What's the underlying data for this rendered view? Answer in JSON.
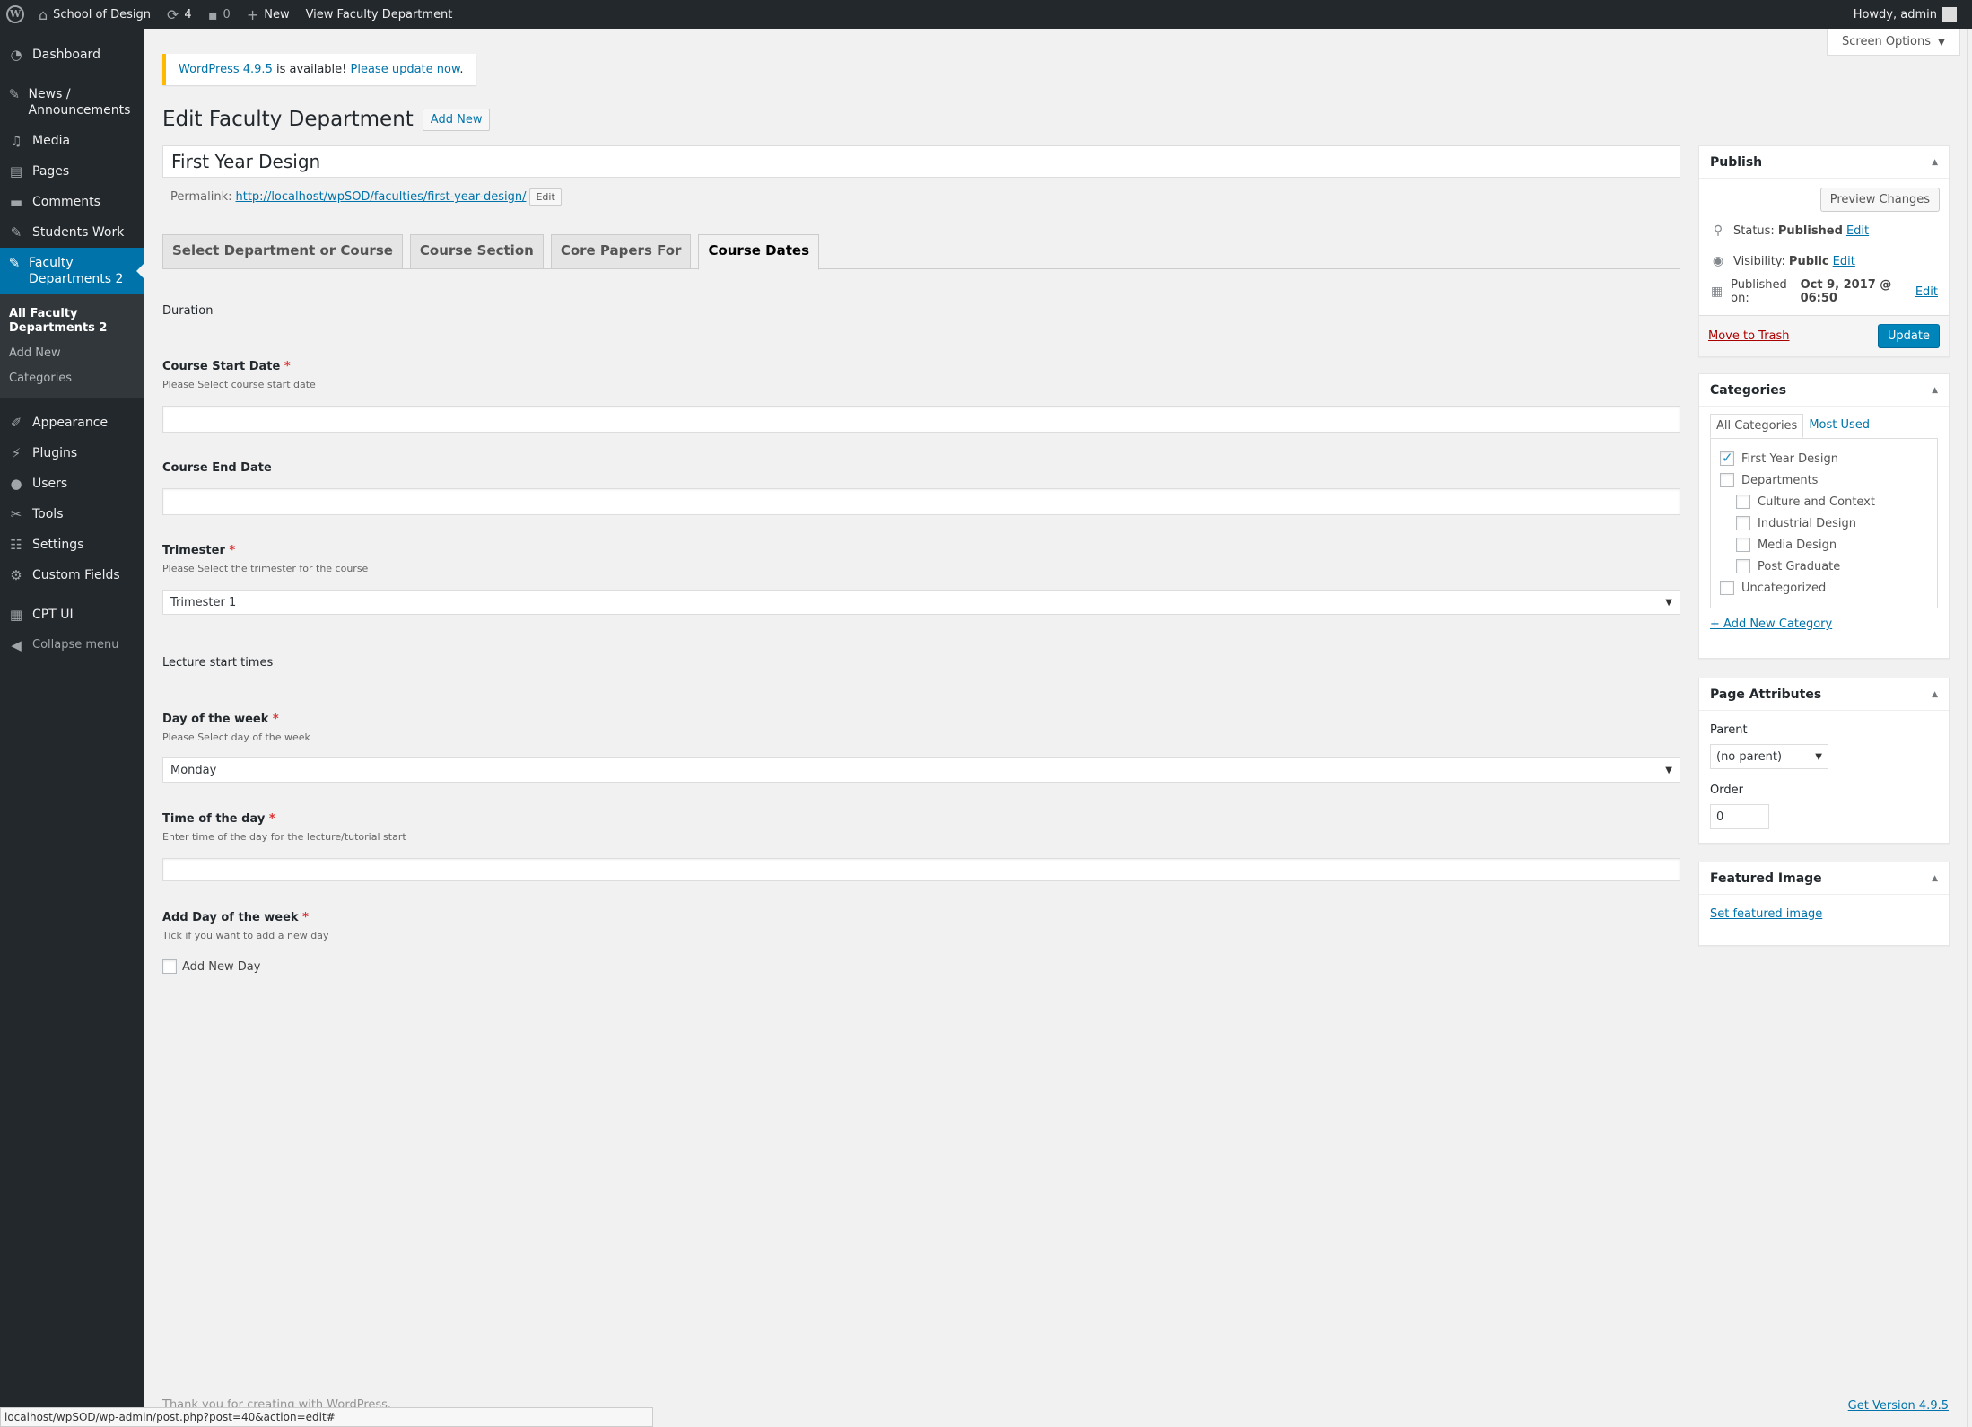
{
  "adminbar": {
    "site_name": "School of Design",
    "updates_count": "4",
    "comments_count": "0",
    "new_label": "New",
    "view_label": "View Faculty Department",
    "howdy": "Howdy, admin"
  },
  "sidebar": {
    "items": [
      {
        "label": "Dashboard",
        "icon": "dashboard-icon"
      },
      {
        "label": "News / Announcements",
        "icon": "pin-icon"
      },
      {
        "label": "Media",
        "icon": "media-icon"
      },
      {
        "label": "Pages",
        "icon": "pages-icon"
      },
      {
        "label": "Comments",
        "icon": "comments-icon"
      },
      {
        "label": "Students Work",
        "icon": "pin-icon"
      },
      {
        "label": "Faculty Departments 2",
        "icon": "pin-icon"
      },
      {
        "label": "Appearance",
        "icon": "appearance-icon"
      },
      {
        "label": "Plugins",
        "icon": "plugins-icon"
      },
      {
        "label": "Users",
        "icon": "users-icon"
      },
      {
        "label": "Tools",
        "icon": "tools-icon"
      },
      {
        "label": "Settings",
        "icon": "settings-icon"
      },
      {
        "label": "Custom Fields",
        "icon": "custom-fields-icon"
      },
      {
        "label": "CPT UI",
        "icon": "cpt-icon"
      },
      {
        "label": "Collapse menu",
        "icon": "collapse-icon"
      }
    ],
    "submenu": [
      "All Faculty Departments 2",
      "Add New",
      "Categories"
    ]
  },
  "screen_options": "Screen Options",
  "notice": {
    "link1": "WordPress 4.9.5",
    "text": " is available! ",
    "link2": "Please update now",
    "end": "."
  },
  "page": {
    "title": "Edit Faculty Department",
    "add_new": "Add New",
    "post_title": "First Year Design",
    "permalink_label": "Permalink:",
    "permalink_url": "http://localhost/wpSOD/faculties/first-year-design/",
    "permalink_edit": "Edit"
  },
  "tabs": [
    "Select Department or Course",
    "Course Section",
    "Core Papers For",
    "Course Dates"
  ],
  "fields": {
    "duration_label": "Duration",
    "start_label": "Course Start Date",
    "start_desc": "Please Select course start date",
    "end_label": "Course End Date",
    "trimester_label": "Trimester",
    "trimester_desc": "Please Select the trimester for the course",
    "trimester_value": "Trimester 1",
    "lecture_label": "Lecture start times",
    "day_label": "Day of the week",
    "day_desc": "Please Select day of the week",
    "day_value": "Monday",
    "time_label": "Time of the day",
    "time_desc": "Enter time of the day for the lecture/tutorial start",
    "add_day_label": "Add Day of the week",
    "add_day_desc": "Tick if you want to add a new day",
    "add_day_checkbox": "Add New Day",
    "required_mark": "*"
  },
  "publish": {
    "title": "Publish",
    "preview": "Preview Changes",
    "status_label": "Status:",
    "status_value": "Published",
    "visibility_label": "Visibility:",
    "visibility_value": "Public",
    "published_label": "Published on:",
    "published_value": "Oct 9, 2017 @ 06:50",
    "edit": "Edit",
    "trash": "Move to Trash",
    "update": "Update"
  },
  "categories": {
    "title": "Categories",
    "tab_all": "All Categories",
    "tab_used": "Most Used",
    "items": [
      {
        "label": "First Year Design",
        "checked": true,
        "child": false
      },
      {
        "label": "Departments",
        "checked": false,
        "child": false
      },
      {
        "label": "Culture and Context",
        "checked": false,
        "child": true
      },
      {
        "label": "Industrial Design",
        "checked": false,
        "child": true
      },
      {
        "label": "Media Design",
        "checked": false,
        "child": true
      },
      {
        "label": "Post Graduate",
        "checked": false,
        "child": true
      },
      {
        "label": "Uncategorized",
        "checked": false,
        "child": false
      }
    ],
    "add_new": "+ Add New Category"
  },
  "page_attributes": {
    "title": "Page Attributes",
    "parent_label": "Parent",
    "parent_value": "(no parent)",
    "order_label": "Order",
    "order_value": "0"
  },
  "featured": {
    "title": "Featured Image",
    "link": "Set featured image"
  },
  "footer": {
    "thanks": "Thank you for creating with WordPress.",
    "version": "Get Version 4.9.5"
  },
  "statusbar": "localhost/wpSOD/wp-admin/post.php?post=40&action=edit#",
  "colors": {
    "accent": "#0073aa",
    "primary_button": "#0085ba",
    "sidebar_bg": "#23282d",
    "notice_border": "#ffb900"
  }
}
